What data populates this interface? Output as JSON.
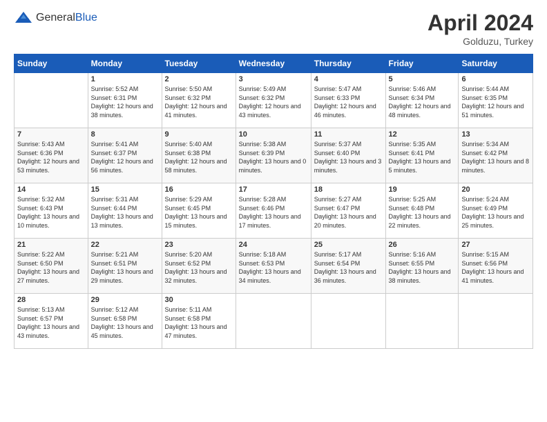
{
  "logo": {
    "general": "General",
    "blue": "Blue"
  },
  "title": {
    "month_year": "April 2024",
    "location": "Golduzu, Turkey"
  },
  "weekdays": [
    "Sunday",
    "Monday",
    "Tuesday",
    "Wednesday",
    "Thursday",
    "Friday",
    "Saturday"
  ],
  "weeks": [
    [
      {
        "day": "",
        "sunrise": "",
        "sunset": "",
        "daylight": ""
      },
      {
        "day": "1",
        "sunrise": "Sunrise: 5:52 AM",
        "sunset": "Sunset: 6:31 PM",
        "daylight": "Daylight: 12 hours and 38 minutes."
      },
      {
        "day": "2",
        "sunrise": "Sunrise: 5:50 AM",
        "sunset": "Sunset: 6:32 PM",
        "daylight": "Daylight: 12 hours and 41 minutes."
      },
      {
        "day": "3",
        "sunrise": "Sunrise: 5:49 AM",
        "sunset": "Sunset: 6:32 PM",
        "daylight": "Daylight: 12 hours and 43 minutes."
      },
      {
        "day": "4",
        "sunrise": "Sunrise: 5:47 AM",
        "sunset": "Sunset: 6:33 PM",
        "daylight": "Daylight: 12 hours and 46 minutes."
      },
      {
        "day": "5",
        "sunrise": "Sunrise: 5:46 AM",
        "sunset": "Sunset: 6:34 PM",
        "daylight": "Daylight: 12 hours and 48 minutes."
      },
      {
        "day": "6",
        "sunrise": "Sunrise: 5:44 AM",
        "sunset": "Sunset: 6:35 PM",
        "daylight": "Daylight: 12 hours and 51 minutes."
      }
    ],
    [
      {
        "day": "7",
        "sunrise": "Sunrise: 5:43 AM",
        "sunset": "Sunset: 6:36 PM",
        "daylight": "Daylight: 12 hours and 53 minutes."
      },
      {
        "day": "8",
        "sunrise": "Sunrise: 5:41 AM",
        "sunset": "Sunset: 6:37 PM",
        "daylight": "Daylight: 12 hours and 56 minutes."
      },
      {
        "day": "9",
        "sunrise": "Sunrise: 5:40 AM",
        "sunset": "Sunset: 6:38 PM",
        "daylight": "Daylight: 12 hours and 58 minutes."
      },
      {
        "day": "10",
        "sunrise": "Sunrise: 5:38 AM",
        "sunset": "Sunset: 6:39 PM",
        "daylight": "Daylight: 13 hours and 0 minutes."
      },
      {
        "day": "11",
        "sunrise": "Sunrise: 5:37 AM",
        "sunset": "Sunset: 6:40 PM",
        "daylight": "Daylight: 13 hours and 3 minutes."
      },
      {
        "day": "12",
        "sunrise": "Sunrise: 5:35 AM",
        "sunset": "Sunset: 6:41 PM",
        "daylight": "Daylight: 13 hours and 5 minutes."
      },
      {
        "day": "13",
        "sunrise": "Sunrise: 5:34 AM",
        "sunset": "Sunset: 6:42 PM",
        "daylight": "Daylight: 13 hours and 8 minutes."
      }
    ],
    [
      {
        "day": "14",
        "sunrise": "Sunrise: 5:32 AM",
        "sunset": "Sunset: 6:43 PM",
        "daylight": "Daylight: 13 hours and 10 minutes."
      },
      {
        "day": "15",
        "sunrise": "Sunrise: 5:31 AM",
        "sunset": "Sunset: 6:44 PM",
        "daylight": "Daylight: 13 hours and 13 minutes."
      },
      {
        "day": "16",
        "sunrise": "Sunrise: 5:29 AM",
        "sunset": "Sunset: 6:45 PM",
        "daylight": "Daylight: 13 hours and 15 minutes."
      },
      {
        "day": "17",
        "sunrise": "Sunrise: 5:28 AM",
        "sunset": "Sunset: 6:46 PM",
        "daylight": "Daylight: 13 hours and 17 minutes."
      },
      {
        "day": "18",
        "sunrise": "Sunrise: 5:27 AM",
        "sunset": "Sunset: 6:47 PM",
        "daylight": "Daylight: 13 hours and 20 minutes."
      },
      {
        "day": "19",
        "sunrise": "Sunrise: 5:25 AM",
        "sunset": "Sunset: 6:48 PM",
        "daylight": "Daylight: 13 hours and 22 minutes."
      },
      {
        "day": "20",
        "sunrise": "Sunrise: 5:24 AM",
        "sunset": "Sunset: 6:49 PM",
        "daylight": "Daylight: 13 hours and 25 minutes."
      }
    ],
    [
      {
        "day": "21",
        "sunrise": "Sunrise: 5:22 AM",
        "sunset": "Sunset: 6:50 PM",
        "daylight": "Daylight: 13 hours and 27 minutes."
      },
      {
        "day": "22",
        "sunrise": "Sunrise: 5:21 AM",
        "sunset": "Sunset: 6:51 PM",
        "daylight": "Daylight: 13 hours and 29 minutes."
      },
      {
        "day": "23",
        "sunrise": "Sunrise: 5:20 AM",
        "sunset": "Sunset: 6:52 PM",
        "daylight": "Daylight: 13 hours and 32 minutes."
      },
      {
        "day": "24",
        "sunrise": "Sunrise: 5:18 AM",
        "sunset": "Sunset: 6:53 PM",
        "daylight": "Daylight: 13 hours and 34 minutes."
      },
      {
        "day": "25",
        "sunrise": "Sunrise: 5:17 AM",
        "sunset": "Sunset: 6:54 PM",
        "daylight": "Daylight: 13 hours and 36 minutes."
      },
      {
        "day": "26",
        "sunrise": "Sunrise: 5:16 AM",
        "sunset": "Sunset: 6:55 PM",
        "daylight": "Daylight: 13 hours and 38 minutes."
      },
      {
        "day": "27",
        "sunrise": "Sunrise: 5:15 AM",
        "sunset": "Sunset: 6:56 PM",
        "daylight": "Daylight: 13 hours and 41 minutes."
      }
    ],
    [
      {
        "day": "28",
        "sunrise": "Sunrise: 5:13 AM",
        "sunset": "Sunset: 6:57 PM",
        "daylight": "Daylight: 13 hours and 43 minutes."
      },
      {
        "day": "29",
        "sunrise": "Sunrise: 5:12 AM",
        "sunset": "Sunset: 6:58 PM",
        "daylight": "Daylight: 13 hours and 45 minutes."
      },
      {
        "day": "30",
        "sunrise": "Sunrise: 5:11 AM",
        "sunset": "Sunset: 6:58 PM",
        "daylight": "Daylight: 13 hours and 47 minutes."
      },
      {
        "day": "",
        "sunrise": "",
        "sunset": "",
        "daylight": ""
      },
      {
        "day": "",
        "sunrise": "",
        "sunset": "",
        "daylight": ""
      },
      {
        "day": "",
        "sunrise": "",
        "sunset": "",
        "daylight": ""
      },
      {
        "day": "",
        "sunrise": "",
        "sunset": "",
        "daylight": ""
      }
    ]
  ]
}
